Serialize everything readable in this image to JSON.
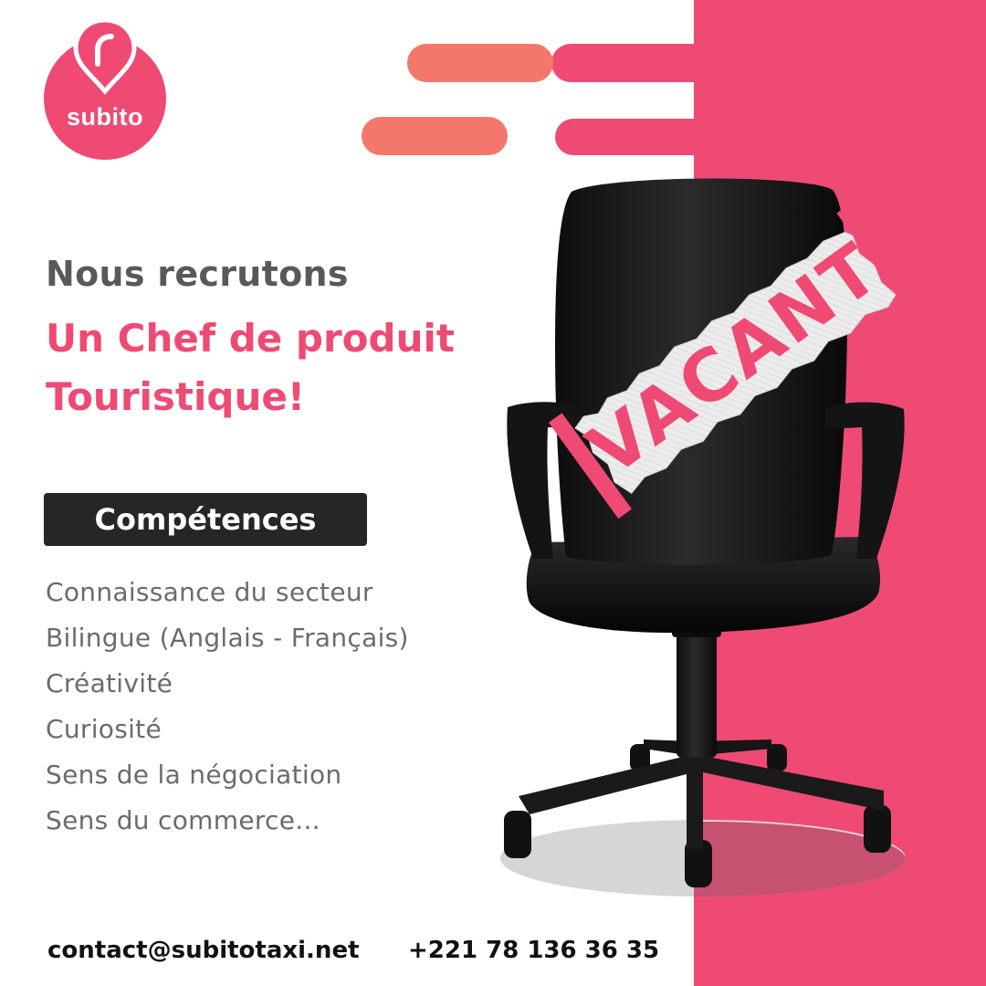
{
  "brand": {
    "name": "subito",
    "color": "#ef4a74",
    "icon": "location-pin-icon"
  },
  "headline": "Nous recrutons",
  "position": {
    "line1": "Un Chef de produit",
    "line2": "Touristique!"
  },
  "skills": {
    "title": "Compétences",
    "items": [
      "Connaissance du secteur",
      "Bilingue (Anglais - Français)",
      "Créativité",
      "Curiosité",
      "Sens de la négociation",
      "Sens du commerce..."
    ]
  },
  "sign": {
    "text": "VACANT"
  },
  "contact": {
    "email": "contact@subitotaxi.net",
    "phone": "+221 78 136 36 35"
  },
  "colors": {
    "accent": "#ef4a74",
    "coral": "#f4776b",
    "text_gray": "#58595b",
    "dark": "#262626"
  }
}
